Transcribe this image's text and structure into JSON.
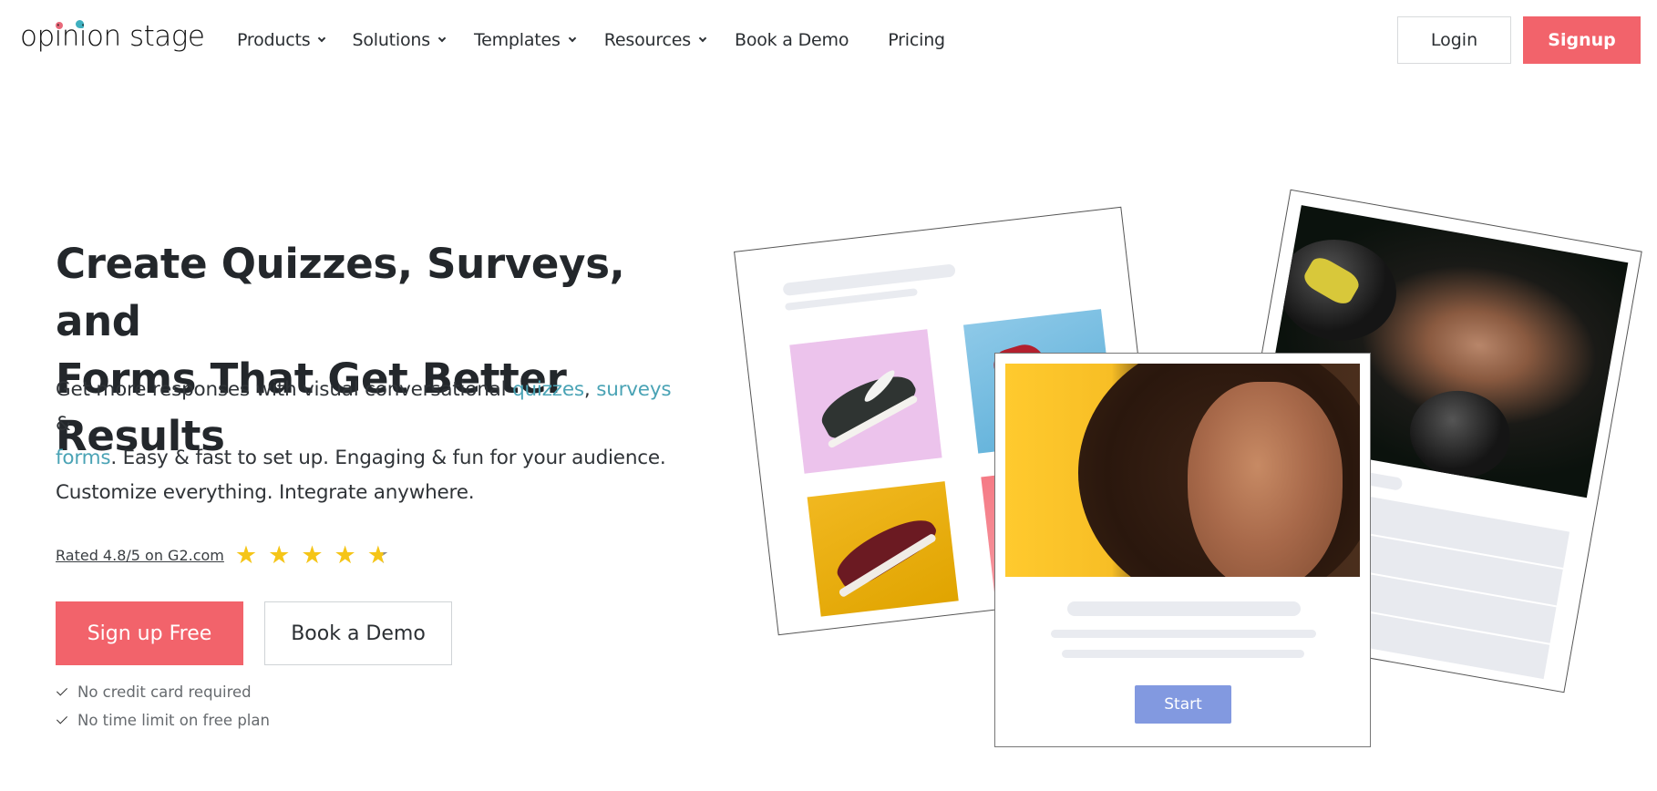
{
  "header": {
    "logo_text": "opinion stage",
    "nav": [
      {
        "label": "Products",
        "has_dropdown": true
      },
      {
        "label": "Solutions",
        "has_dropdown": true
      },
      {
        "label": "Templates",
        "has_dropdown": true
      },
      {
        "label": "Resources",
        "has_dropdown": true
      },
      {
        "label": "Book a Demo",
        "has_dropdown": false
      },
      {
        "label": "Pricing",
        "has_dropdown": false
      }
    ],
    "login_label": "Login",
    "signup_label": "Signup"
  },
  "hero": {
    "title_line1": "Create Quizzes, Surveys, and",
    "title_line2": "Forms That Get Better Results",
    "desc_part1": "Get more responses with visual conversational ",
    "link_quizzes": "quizzes",
    "desc_comma": ", ",
    "link_surveys": "surveys",
    "desc_amp": " &",
    "link_forms": "forms",
    "desc_part2": ". Easy & fast to set up. Engaging & fun for your audience. Customize everything. Integrate anywhere.",
    "rating_text": "Rated 4.8/5 on G2.com",
    "rating_value": 4.8,
    "rating_max": 5,
    "primary_cta": "Sign up Free",
    "secondary_cta": "Book a Demo",
    "checks": [
      "No credit card required",
      "No time limit on free plan"
    ]
  },
  "illustration": {
    "start_button_label": "Start"
  },
  "colors": {
    "brand_coral": "#f2636b",
    "link_teal": "#4aa3b5",
    "star_gold": "#f5c518",
    "start_button": "#8299e0",
    "logo_dot_pink": "#e8697a",
    "logo_dot_teal": "#3fb0c0"
  }
}
